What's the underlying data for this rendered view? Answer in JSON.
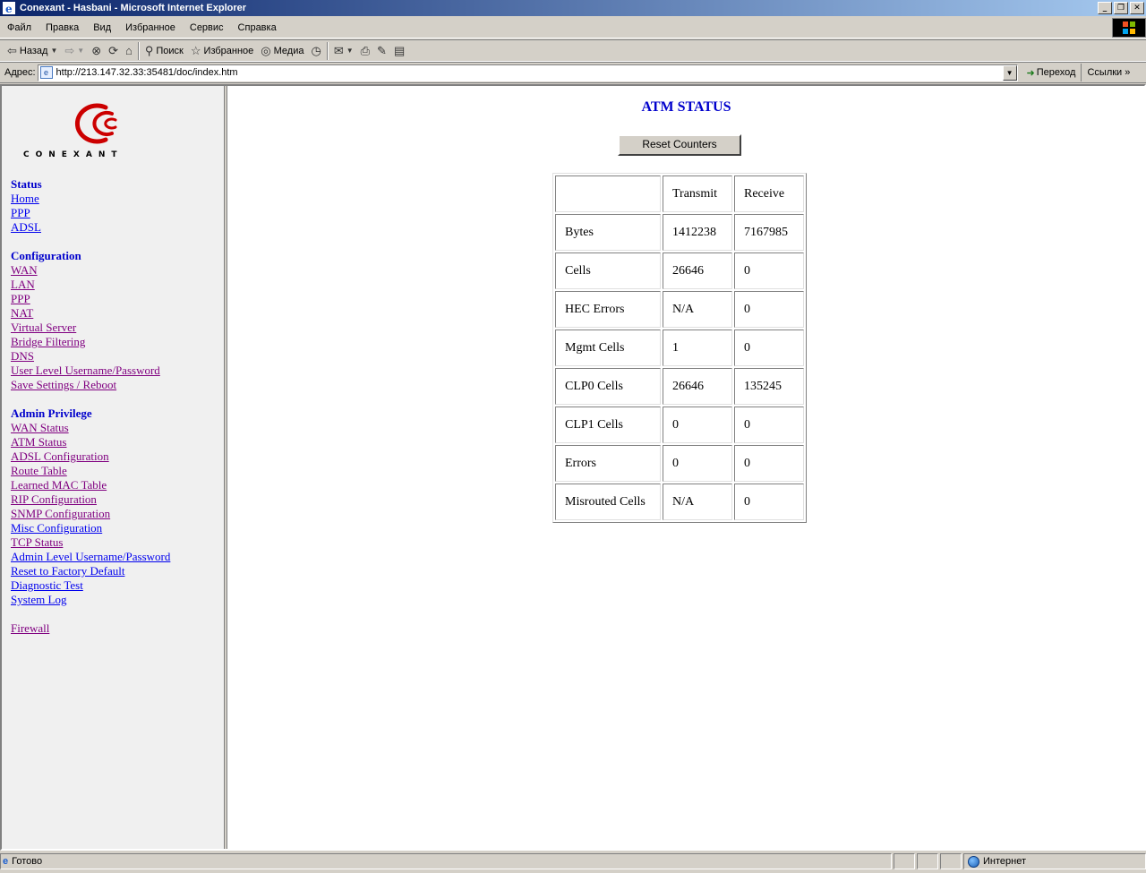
{
  "window": {
    "title": "Conexant - Hasbani - Microsoft Internet Explorer"
  },
  "menu": [
    "Файл",
    "Правка",
    "Вид",
    "Избранное",
    "Сервис",
    "Справка"
  ],
  "toolbar": {
    "back": "Назад",
    "search": "Поиск",
    "favorites": "Избранное",
    "media": "Медиа"
  },
  "address": {
    "label": "Адрес:",
    "url": "http://213.147.32.33:35481/doc/index.htm",
    "go": "Переход",
    "links": "Ссылки"
  },
  "logo": {
    "text": "CONEXANT"
  },
  "nav": {
    "status_title": "Status",
    "status_links": [
      "Home",
      "PPP",
      "ADSL"
    ],
    "config_title": "Configuration",
    "config_links": [
      "WAN",
      "LAN",
      "PPP",
      "NAT",
      "Virtual Server",
      "Bridge Filtering",
      "DNS",
      "User Level Username/Password",
      "Save Settings / Reboot"
    ],
    "admin_title": "Admin Privilege",
    "admin_links": [
      "WAN Status",
      "ATM Status",
      "ADSL Configuration",
      "Route Table",
      "Learned MAC Table",
      "RIP Configuration",
      "SNMP Configuration",
      "Misc Configuration",
      "TCP Status",
      "Admin Level Username/Password",
      "Reset to Factory Default",
      "Diagnostic Test",
      "System Log"
    ],
    "firewall": "Firewall"
  },
  "main": {
    "title": "ATM STATUS",
    "reset_button": "Reset Counters",
    "columns": [
      "",
      "Transmit",
      "Receive"
    ],
    "rows": [
      [
        "Bytes",
        "1412238",
        "7167985"
      ],
      [
        "Cells",
        "26646",
        "0"
      ],
      [
        "HEC Errors",
        "N/A",
        "0"
      ],
      [
        "Mgmt Cells",
        "1",
        "0"
      ],
      [
        "CLP0 Cells",
        "26646",
        "135245"
      ],
      [
        "CLP1 Cells",
        "0",
        "0"
      ],
      [
        "Errors",
        "0",
        "0"
      ],
      [
        "Misrouted Cells",
        "N/A",
        "0"
      ]
    ]
  },
  "status": {
    "text": "Готово",
    "zone": "Интернет"
  }
}
